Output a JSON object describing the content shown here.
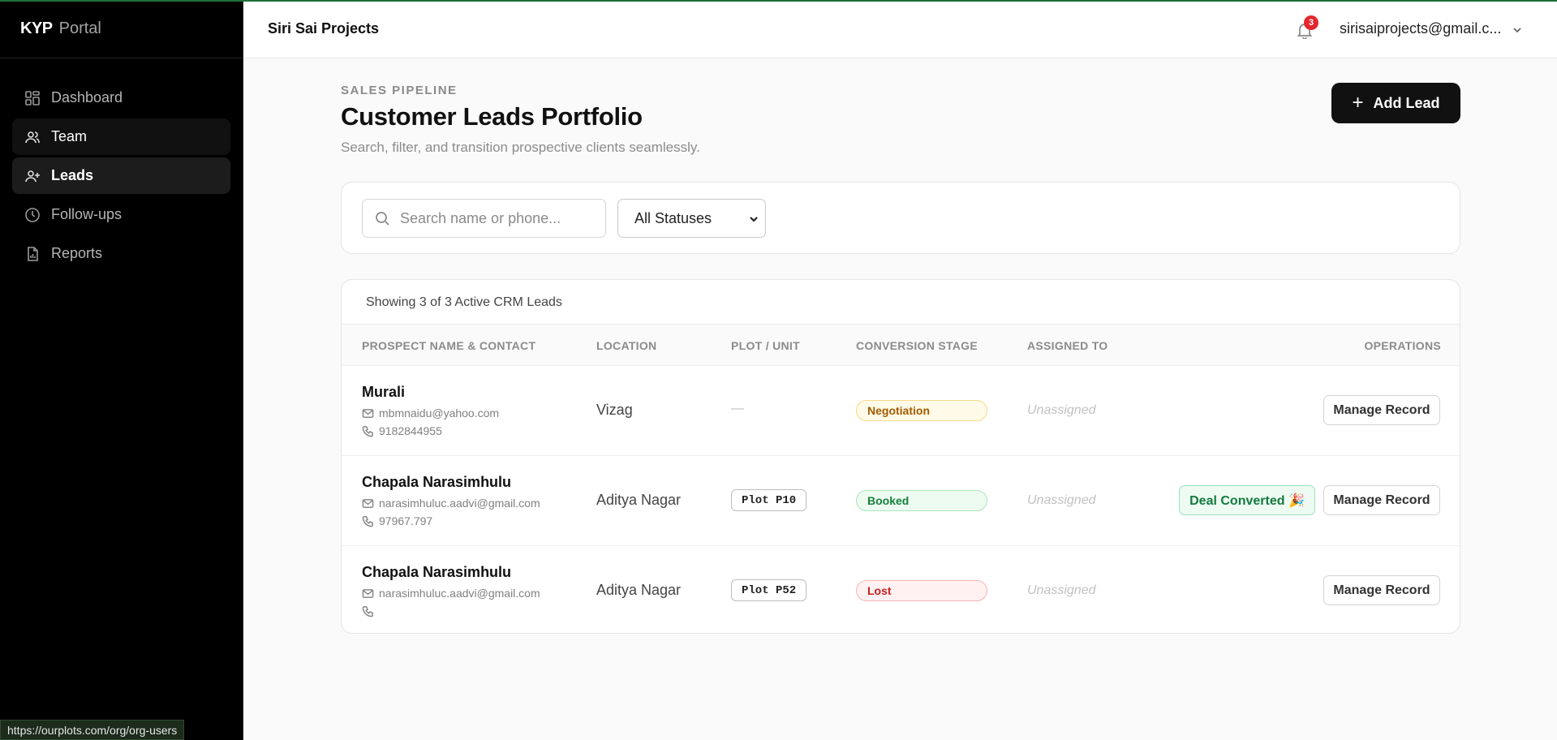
{
  "brand": {
    "bold": "KYP",
    "light": "Portal"
  },
  "sidebar": {
    "items": [
      {
        "label": "Dashboard",
        "icon": "dashboard-icon"
      },
      {
        "label": "Team",
        "icon": "team-icon"
      },
      {
        "label": "Leads",
        "icon": "add-user-icon"
      },
      {
        "label": "Follow-ups",
        "icon": "clock-icon"
      },
      {
        "label": "Reports",
        "icon": "report-icon"
      }
    ],
    "active": "Leads"
  },
  "status_url": "https://ourplots.com/org/org-users",
  "header": {
    "org_name": "Siri Sai Projects",
    "notification_count": "3",
    "user_email": "sirisaiprojects@gmail.c..."
  },
  "page": {
    "eyebrow": "SALES PIPELINE",
    "title": "Customer Leads Portfolio",
    "subtitle": "Search, filter, and transition prospective clients seamlessly.",
    "add_button": "Add Lead"
  },
  "filters": {
    "search_placeholder": "Search name or phone...",
    "status_selected": "All Statuses"
  },
  "table": {
    "showing_text": "Showing 3 of 3 Active CRM Leads",
    "columns": [
      "PROSPECT NAME & CONTACT",
      "LOCATION",
      "PLOT / UNIT",
      "CONVERSION STAGE",
      "ASSIGNED TO",
      "OPERATIONS"
    ],
    "rows": [
      {
        "name": "Murali",
        "email": "mbmnaidu@yahoo.com",
        "phone": "9182844955",
        "location": "Vizag",
        "plot": "—",
        "stage": "Negotiation",
        "assigned": "Unassigned",
        "deal_badge": "",
        "action": "Manage Record"
      },
      {
        "name": "Chapala Narasimhulu",
        "email": "narasimhuluc.aadvi@gmail.com",
        "phone": "97967.797",
        "location": "Aditya Nagar",
        "plot": "Plot P10",
        "stage": "Booked",
        "assigned": "Unassigned",
        "deal_badge": "Deal Converted 🎉",
        "action": "Manage Record"
      },
      {
        "name": "Chapala Narasimhulu",
        "email": "narasimhuluc.aadvi@gmail.com",
        "phone": "",
        "location": "Aditya Nagar",
        "plot": "Plot P52",
        "stage": "Lost",
        "assigned": "Unassigned",
        "deal_badge": "",
        "action": "Manage Record"
      }
    ]
  },
  "colors": {
    "sidebar_bg": "#000000",
    "primary_button": "#111111",
    "badge_red": "#e5262b",
    "stage_negotiation": "#a45a00",
    "stage_booked": "#16803c",
    "stage_lost": "#c81e1e"
  }
}
